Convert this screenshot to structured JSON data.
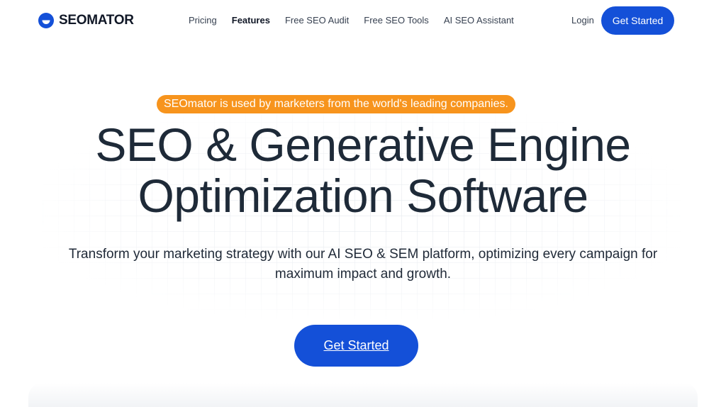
{
  "brand": {
    "name": "SEOMATOR",
    "accent_color": "#1450d8",
    "badge_color": "#f7941d"
  },
  "nav": {
    "items": [
      {
        "label": "Pricing",
        "active": false
      },
      {
        "label": "Features",
        "active": true
      },
      {
        "label": "Free SEO Audit",
        "active": false
      },
      {
        "label": "Free SEO Tools",
        "active": false
      },
      {
        "label": "AI SEO Assistant",
        "active": false
      }
    ],
    "login_label": "Login",
    "cta_label": "Get Started"
  },
  "hero": {
    "badge": "SEOmator is used by marketers from the world's leading companies.",
    "title_line1": "SEO & Generative Engine",
    "title_line2": "Optimization Software",
    "subtitle": "Transform your marketing strategy with our AI SEO & SEM platform, optimizing every campaign for maximum impact and growth.",
    "cta_label": "Get Started"
  },
  "icons": {
    "logo": "seomator-logo-icon"
  }
}
